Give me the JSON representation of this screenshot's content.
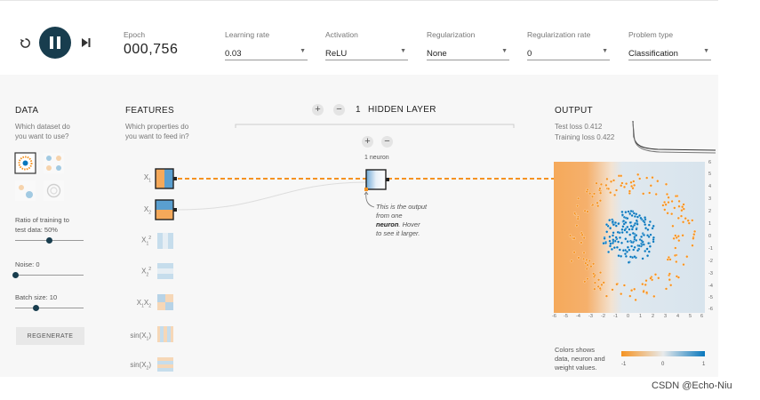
{
  "controls": {
    "reset_icon": "reset-icon",
    "play_pause_icon": "pause-icon",
    "step_icon": "step-forward-icon"
  },
  "epoch": {
    "label": "Epoch",
    "value": "000,756"
  },
  "settings": [
    {
      "label": "Learning rate",
      "value": "0.03"
    },
    {
      "label": "Activation",
      "value": "ReLU"
    },
    {
      "label": "Regularization",
      "value": "None"
    },
    {
      "label": "Regularization rate",
      "value": "0"
    },
    {
      "label": "Problem type",
      "value": "Classification"
    }
  ],
  "data_panel": {
    "title": "DATA",
    "subtitle_line1": "Which dataset do",
    "subtitle_line2": "you want to use?",
    "ratio_label_line1": "Ratio of training to",
    "ratio_label_line2": "test data:  50%",
    "ratio_value": 0.5,
    "noise_label": "Noise:  0",
    "noise_value": 0,
    "batch_label": "Batch size:  10",
    "batch_value": 0.3,
    "regenerate_label": "REGENERATE"
  },
  "features_panel": {
    "title": "FEATURES",
    "subtitle_line1": "Which properties do",
    "subtitle_line2": "you want to feed in?",
    "features": [
      {
        "base": "X",
        "sub": "1",
        "sup": "",
        "active": true
      },
      {
        "base": "X",
        "sub": "2",
        "sup": "",
        "active": true
      },
      {
        "base": "X",
        "sub": "1",
        "sup": "2",
        "active": false
      },
      {
        "base": "X",
        "sub": "2",
        "sup": "2",
        "active": false
      },
      {
        "base": "X",
        "sub": "1",
        "sup": "",
        "extra": "X",
        "extra_sub": "2",
        "active": false
      },
      {
        "base": "sin(X",
        "sub": "1",
        "sup": "",
        "close": ")",
        "active": false
      },
      {
        "base": "sin(X",
        "sub": "2",
        "sup": "",
        "close": ")",
        "active": false
      }
    ]
  },
  "hidden": {
    "count": "1",
    "label": "HIDDEN LAYER",
    "neuron_label": "1 neuron",
    "tooltip_line1": "This is the output",
    "tooltip_line2": "from one",
    "tooltip_bold": "neuron",
    "tooltip_line3": ". Hover",
    "tooltip_line4": "to see it larger."
  },
  "output": {
    "title": "OUTPUT",
    "test_loss": "Test loss 0.412",
    "training_loss": "Training loss 0.422",
    "y_ticks": [
      "6",
      "5",
      "4",
      "3",
      "2",
      "1",
      "0",
      "-1",
      "-2",
      "-3",
      "-4",
      "-5",
      "-6"
    ],
    "x_ticks": [
      "-6",
      "-5",
      "-4",
      "-3",
      "-2",
      "-1",
      "0",
      "1",
      "2",
      "3",
      "4",
      "5",
      "6"
    ],
    "legend_line1": "Colors shows",
    "legend_line2": "data, neuron and",
    "legend_line3": "weight values.",
    "legend_ticks": [
      "-1",
      "0",
      "1"
    ],
    "colors": {
      "negative": "#f59322",
      "positive": "#0877bd"
    }
  },
  "watermark": "CSDN @Echo-Niu"
}
